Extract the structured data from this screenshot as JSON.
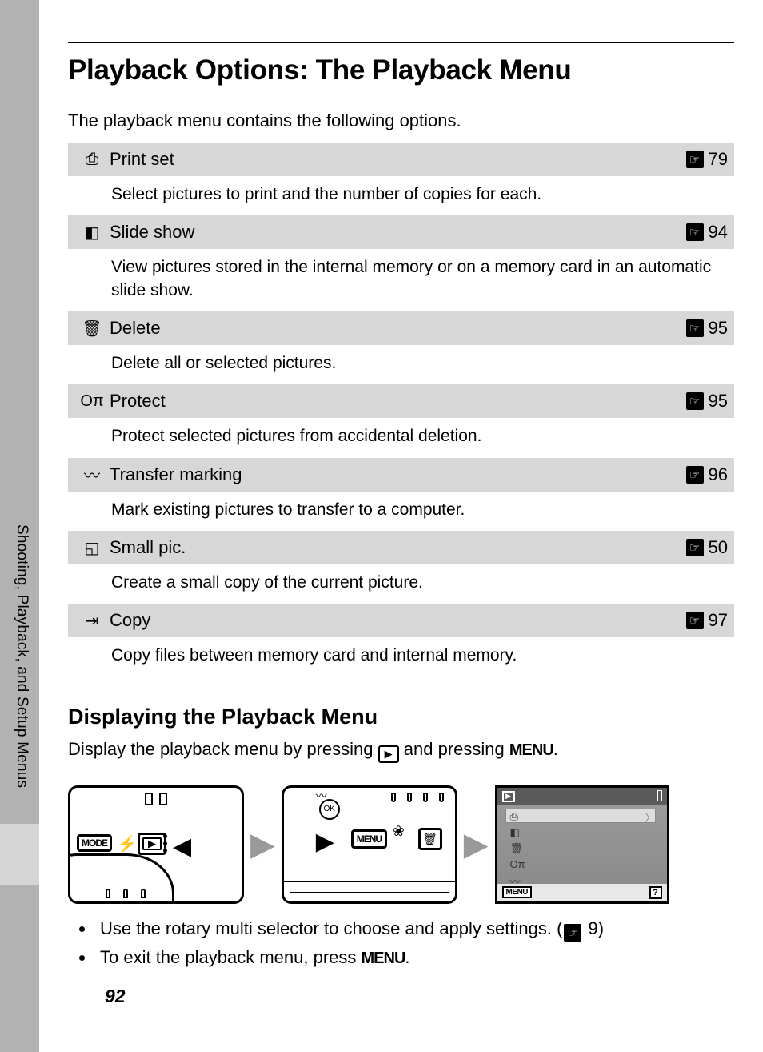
{
  "sideTab": "Shooting, Playback, and Setup Menus",
  "title": "Playback Options: The Playback Menu",
  "intro": "The playback menu contains the following options.",
  "options": [
    {
      "icon": "⎙",
      "iconName": "print-icon",
      "title": "Print set",
      "page": "79",
      "desc": "Select pictures to print and the number of copies for each."
    },
    {
      "icon": "◧",
      "iconName": "slideshow-icon",
      "title": "Slide show",
      "page": "94",
      "desc": "View pictures stored in the internal memory or on a memory card in an automatic slide show."
    },
    {
      "icon": "🗑",
      "iconName": "trash-icon",
      "title": "Delete",
      "page": "95",
      "desc": "Delete all or selected pictures."
    },
    {
      "icon": "Oπ",
      "iconName": "protect-icon",
      "title": "Protect",
      "page": "95",
      "desc": "Protect selected pictures from accidental deletion."
    },
    {
      "icon": "〰",
      "iconName": "transfer-icon",
      "title": "Transfer marking",
      "page": "96",
      "desc": "Mark existing pictures to transfer to a computer."
    },
    {
      "icon": "◱",
      "iconName": "smallpic-icon",
      "title": "Small pic.",
      "page": "50",
      "desc": "Create a small copy of the current picture."
    },
    {
      "icon": "⇥",
      "iconName": "copy-icon",
      "title": "Copy",
      "page": "97",
      "desc": "Copy files between memory card and internal memory."
    }
  ],
  "subhead": "Displaying the Playback Menu",
  "subintro": {
    "pre": "Display the playback menu by pressing ",
    "mid": " and pressing ",
    "menuWord": "MENU",
    "post": "."
  },
  "notes": {
    "n1a": "Use the rotary multi selector to choose and apply settings. (",
    "n1page": "9",
    "n1b": ")",
    "n2a": "To exit the playback menu, press ",
    "n2menu": "MENU",
    "n2b": "."
  },
  "pageNumber": "92",
  "refIconGlyph": "☞",
  "diagramLabels": {
    "mode": "MODE",
    "menu": "MENU",
    "ok": "OK",
    "help": "?"
  }
}
